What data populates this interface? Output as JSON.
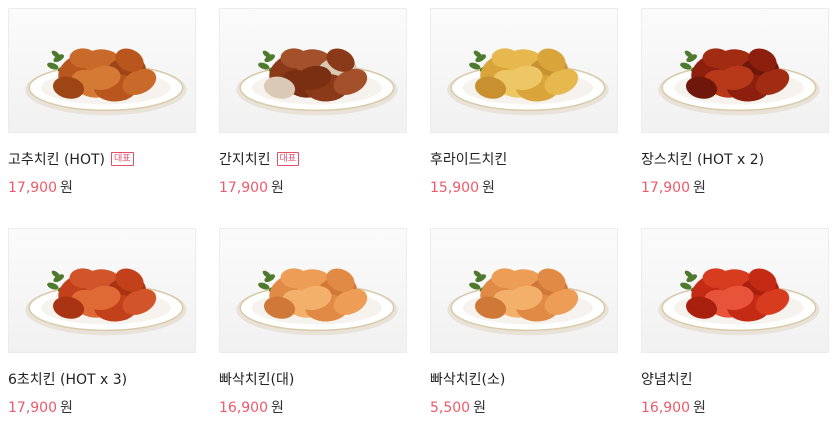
{
  "menu": [
    {
      "name": "고추치킨 (HOT)",
      "badge": "대표",
      "price": "17,900",
      "currency": "원",
      "style": "spicy"
    },
    {
      "name": "간지치킨",
      "badge": "대표",
      "price": "17,900",
      "currency": "원",
      "style": "garlic"
    },
    {
      "name": "후라이드치킨",
      "badge": "",
      "price": "15,900",
      "currency": "원",
      "style": "fried"
    },
    {
      "name": "장스치킨 (HOT x 2)",
      "badge": "",
      "price": "17,900",
      "currency": "원",
      "style": "dark"
    },
    {
      "name": "6초치킨 (HOT x 3)",
      "badge": "",
      "price": "17,900",
      "currency": "원",
      "style": "redhot"
    },
    {
      "name": "빠삭치킨(대)",
      "badge": "",
      "price": "16,900",
      "currency": "원",
      "style": "tender"
    },
    {
      "name": "빠삭치킨(소)",
      "badge": "",
      "price": "5,500",
      "currency": "원",
      "style": "tender"
    },
    {
      "name": "양념치킨",
      "badge": "",
      "price": "16,900",
      "currency": "원",
      "style": "yangnyeom"
    }
  ]
}
